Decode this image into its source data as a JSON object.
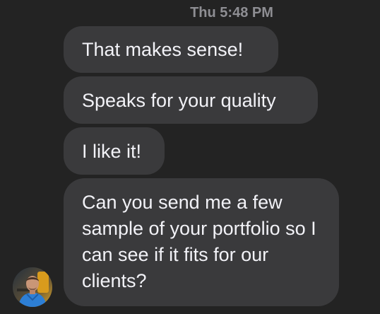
{
  "conversation": {
    "timestamp": "Thu 5:48 PM",
    "messages": [
      {
        "text": "That makes sense!"
      },
      {
        "text": "Speaks for your quality"
      },
      {
        "text": "I like it!"
      },
      {
        "text": "Can you send me a few sample of your portfolio so I can see if it fits for our clients?"
      }
    ]
  },
  "contact": {
    "avatar_icon": "contact-avatar"
  },
  "colors": {
    "background": "#232323",
    "bubble": "#3a3a3c",
    "text": "#f2f2f7",
    "timestamp": "#8e8e93"
  }
}
